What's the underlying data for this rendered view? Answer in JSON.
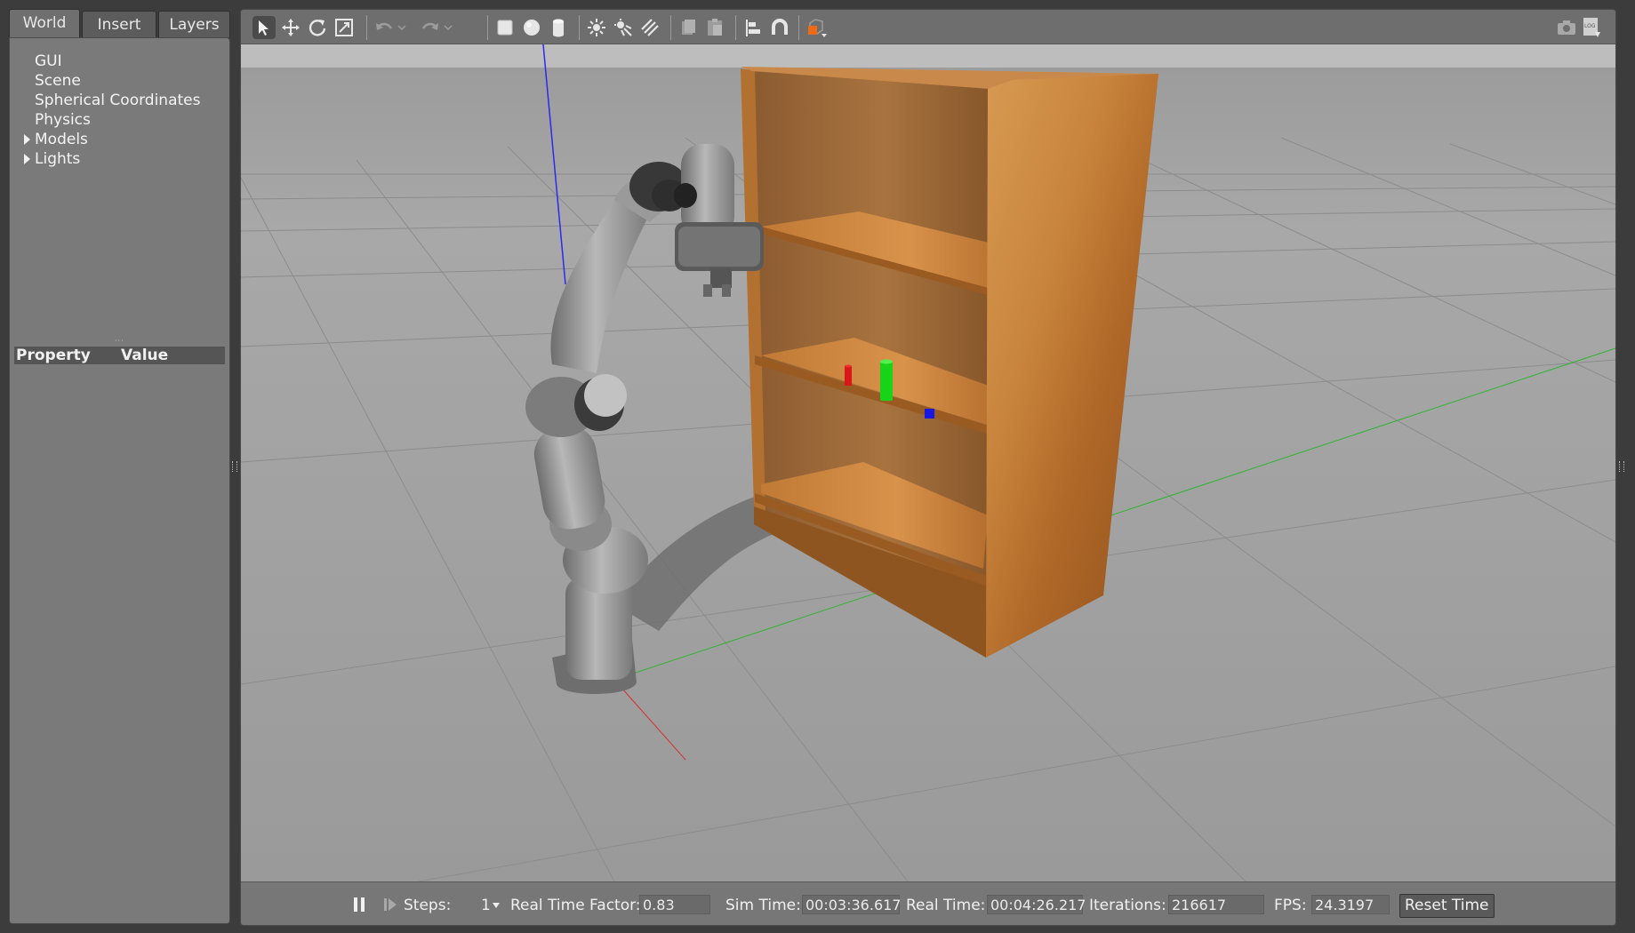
{
  "left_panel": {
    "tabs": [
      "World",
      "Insert",
      "Layers"
    ],
    "active_tab": "World",
    "tree": [
      {
        "label": "GUI",
        "expandable": false
      },
      {
        "label": "Scene",
        "expandable": false
      },
      {
        "label": "Spherical Coordinates",
        "expandable": false
      },
      {
        "label": "Physics",
        "expandable": false
      },
      {
        "label": "Models",
        "expandable": true
      },
      {
        "label": "Lights",
        "expandable": true
      }
    ],
    "property_header": {
      "property": "Property",
      "value": "Value"
    }
  },
  "toolbar": {
    "tools": [
      "select-arrow-icon",
      "translate-icon",
      "rotate-icon",
      "scale-icon",
      "undo-icon",
      "redo-icon",
      "box-shape-icon",
      "sphere-shape-icon",
      "cylinder-shape-icon",
      "point-light-icon",
      "spot-light-icon",
      "directional-light-icon",
      "copy-icon",
      "paste-icon",
      "align-icon",
      "snap-icon",
      "view-angle-icon",
      "screenshot-icon",
      "log-icon"
    ]
  },
  "scene": {
    "robot_color": "#8f8f8f",
    "shelf_color": "#c07a35",
    "objects": [
      {
        "name": "red-cylinder",
        "color": "#d81818"
      },
      {
        "name": "green-cylinder",
        "color": "#18d418"
      },
      {
        "name": "blue-cube",
        "color": "#1818e0"
      }
    ]
  },
  "status_bar": {
    "steps_label": "Steps:",
    "steps_value": "1",
    "rtf_label": "Real Time Factor:",
    "rtf_value": "0.83",
    "sim_time_label": "Sim Time:",
    "sim_time_value": "00:03:36.617",
    "real_time_label": "Real Time:",
    "real_time_value": "00:04:26.217",
    "iterations_label": "Iterations:",
    "iterations_value": "216617",
    "fps_label": "FPS:",
    "fps_value": "24.3197",
    "reset_label": "Reset Time"
  }
}
